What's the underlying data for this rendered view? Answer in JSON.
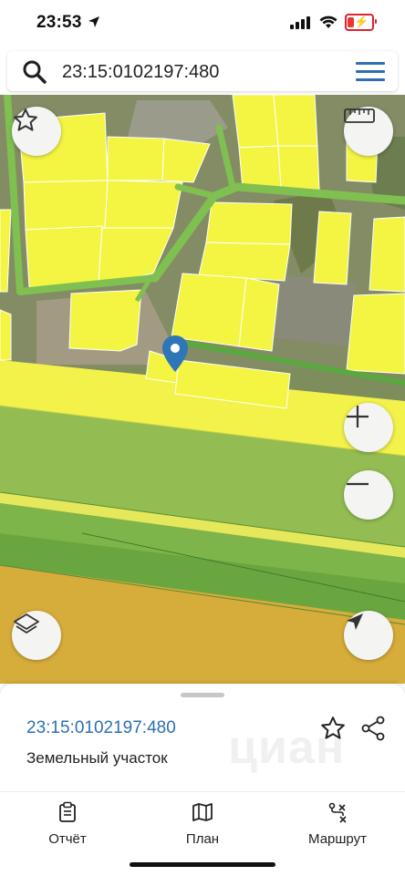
{
  "status_bar": {
    "time": "23:53"
  },
  "search": {
    "value": "23:15:0102197:480"
  },
  "map_controls": {
    "favorite": "star-icon",
    "ruler": "ruler-icon",
    "zoom_in": "plus-icon",
    "zoom_out": "minus-icon",
    "layers": "layers-icon",
    "locate": "navigation-arrow-icon"
  },
  "parcel_card": {
    "cadastral_number": "23:15:0102197:480",
    "type": "Земельный участок",
    "watermark": "циан"
  },
  "tabs": [
    {
      "label": "Отчёт",
      "icon": "report-clipboard-icon"
    },
    {
      "label": "План",
      "icon": "map-icon"
    },
    {
      "label": "Маршрут",
      "icon": "route-icon"
    }
  ],
  "colors": {
    "accent": "#2d6fb3",
    "parcel_yellow": "#f3f542",
    "zone_green": "#8fb84e",
    "zone_dark_green": "#6aa63f",
    "zone_ochre": "#d6ad3a",
    "marker_blue": "#2f76b8"
  }
}
